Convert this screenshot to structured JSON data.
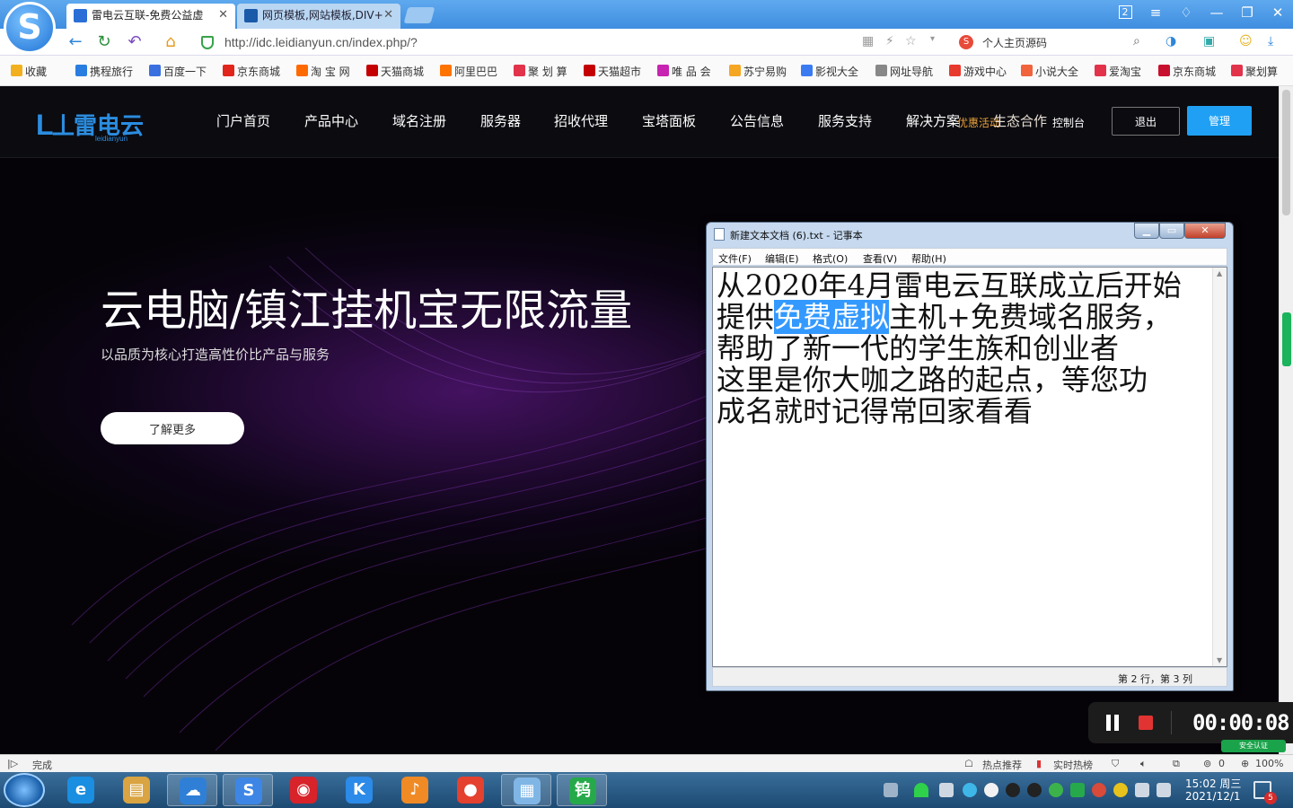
{
  "browser": {
    "tabs": [
      {
        "label": "雷电云互联-免费公益虚",
        "color": "#2b6fd6"
      },
      {
        "label": "网页模板,网站模板,DIV+",
        "color": "#1a5aa8"
      }
    ],
    "url": "http://idc.leidianyun.cn/index.php/?",
    "search_value": "个人主页源码",
    "window_badge": "2",
    "favorites": [
      {
        "label": "收藏",
        "icon": "star-icon",
        "color": "#f2b01e"
      },
      {
        "label": "携程旅行",
        "icon": "ctrip-icon",
        "color": "#2a7de0"
      },
      {
        "label": "百度一下",
        "icon": "baidu-icon",
        "color": "#3a6fe0"
      },
      {
        "label": "京东商城",
        "icon": "jd-icon",
        "color": "#e1251b"
      },
      {
        "label": "淘 宝 网",
        "icon": "taobao-icon",
        "color": "#ff6a00"
      },
      {
        "label": "天猫商城",
        "icon": "tmall-icon",
        "color": "#c40000"
      },
      {
        "label": "阿里巴巴",
        "icon": "alibaba-icon",
        "color": "#ff7300"
      },
      {
        "label": "聚 划 算",
        "icon": "juhuasuan-icon",
        "color": "#e2334b"
      },
      {
        "label": "天猫超市",
        "icon": "tmall-market-icon",
        "color": "#c40000"
      },
      {
        "label": "唯 品 会",
        "icon": "vip-icon",
        "color": "#c724b1"
      },
      {
        "label": "苏宁易购",
        "icon": "suning-icon",
        "color": "#f5a623"
      },
      {
        "label": "影视大全",
        "icon": "video-icon",
        "color": "#3b7bf2"
      },
      {
        "label": "网址导航",
        "icon": "globe-icon",
        "color": "#888888"
      },
      {
        "label": "游戏中心",
        "icon": "game-icon",
        "color": "#e8392d"
      },
      {
        "label": "小说大全",
        "icon": "novel-icon",
        "color": "#f0633c"
      },
      {
        "label": "爱淘宝",
        "icon": "aitaobao-icon",
        "color": "#e2334b"
      },
      {
        "label": "京东商城",
        "icon": "jd-icon",
        "color": "#c8102e"
      },
      {
        "label": "聚划算",
        "icon": "juhuasuan-icon",
        "color": "#e2334b"
      }
    ]
  },
  "site": {
    "logo_text": "雷电云",
    "logo_sub": "leidianyun",
    "nav": [
      "门户首页",
      "产品中心",
      "域名注册",
      "服务器",
      "招收代理",
      "宝塔面板",
      "公告信息",
      "服务支持",
      "解决方案"
    ],
    "nav_overlap": {
      "orange": "优惠活动",
      "white": "生态合作",
      "small": "控制台"
    },
    "logout": "退出",
    "manage": "管理",
    "hero_title": "云电脑/镇江挂机宝无限流量",
    "hero_subtitle": "以品质为核心打造高性价比产品与服务",
    "hero_button": "了解更多",
    "accent": "#1fa0f4",
    "brand": "#2b8de0"
  },
  "notepad": {
    "title": "新建文本文档 (6).txt - 记事本",
    "menus": [
      "文件(F)",
      "编辑(E)",
      "格式(O)",
      "查看(V)",
      "帮助(H)"
    ],
    "line1": "从2020年4月雷电云互联成立后开始",
    "line2_pre": "提供",
    "line2_selected": "免费虚拟",
    "line2_post": "主机+免费域名服务，",
    "line3": "帮助了新一代的学生族和创业者",
    "line4": "这里是你大咖之路的起点，等您功",
    "line5": "成名就时记得常回家看看",
    "status": "第 2 行，第 3 列"
  },
  "recorder": {
    "time": "00:00:08",
    "badge": "安全认证"
  },
  "statusbar": {
    "status": "完成",
    "hot": "热点推荐",
    "realtime": "实时热榜",
    "downloads": "0",
    "zoom": "100%"
  },
  "taskbar": {
    "apps": [
      {
        "name": "ie-icon",
        "glyph": "e",
        "color": "#1a8ee0",
        "running": false
      },
      {
        "name": "explorer-icon",
        "glyph": "▤",
        "color": "#d9a441",
        "running": false
      },
      {
        "name": "cloud-pc-icon",
        "glyph": "☁",
        "color": "#2f7fd6",
        "running": true
      },
      {
        "name": "sogou-browser-icon",
        "glyph": "S",
        "color": "#3d86e6",
        "running": true
      },
      {
        "name": "netease-music-icon",
        "glyph": "◉",
        "color": "#d8232a",
        "running": false
      },
      {
        "name": "kugou-icon",
        "glyph": "K",
        "color": "#2c8ae8",
        "running": false
      },
      {
        "name": "bird-app-icon",
        "glyph": "♪",
        "color": "#f08a24",
        "running": false
      },
      {
        "name": "chrome-icon",
        "glyph": "●",
        "color": "#e4412f",
        "running": false
      },
      {
        "name": "notepad-app-icon",
        "glyph": "▦",
        "color": "#7fb6e6",
        "running": true
      },
      {
        "name": "wps-icon",
        "glyph": "钨",
        "color": "#26a94a",
        "running": true
      }
    ],
    "time": "15:02 周三",
    "date": "2021/12/1",
    "notification_count": "5"
  }
}
